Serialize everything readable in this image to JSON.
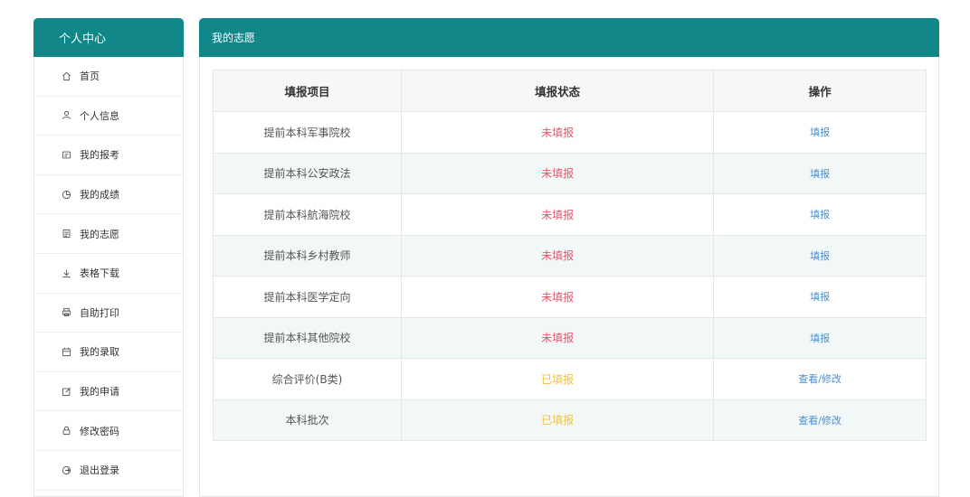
{
  "sidebar": {
    "title": "个人中心",
    "items": [
      {
        "label": "首页",
        "icon": "home-icon"
      },
      {
        "label": "个人信息",
        "icon": "user-icon"
      },
      {
        "label": "我的报考",
        "icon": "id-card-icon"
      },
      {
        "label": "我的成绩",
        "icon": "pie-chart-icon"
      },
      {
        "label": "我的志愿",
        "icon": "document-icon"
      },
      {
        "label": "表格下载",
        "icon": "download-icon"
      },
      {
        "label": "自助打印",
        "icon": "printer-icon"
      },
      {
        "label": "我的录取",
        "icon": "calendar-icon"
      },
      {
        "label": "我的申请",
        "icon": "edit-icon"
      },
      {
        "label": "修改密码",
        "icon": "lock-icon"
      },
      {
        "label": "退出登录",
        "icon": "logout-icon"
      }
    ]
  },
  "main": {
    "title": "我的志愿",
    "table": {
      "headers": [
        "填报项目",
        "填报状态",
        "操作"
      ],
      "rows": [
        {
          "project": "提前本科军事院校",
          "status": "未填报",
          "status_type": "unfilled",
          "action": "填报"
        },
        {
          "project": "提前本科公安政法",
          "status": "未填报",
          "status_type": "unfilled",
          "action": "填报"
        },
        {
          "project": "提前本科航海院校",
          "status": "未填报",
          "status_type": "unfilled",
          "action": "填报"
        },
        {
          "project": "提前本科乡村教师",
          "status": "未填报",
          "status_type": "unfilled",
          "action": "填报"
        },
        {
          "project": "提前本科医学定向",
          "status": "未填报",
          "status_type": "unfilled",
          "action": "填报"
        },
        {
          "project": "提前本科其他院校",
          "status": "未填报",
          "status_type": "unfilled",
          "action": "填报"
        },
        {
          "project": "综合评价(B类)",
          "status": "已填报",
          "status_type": "filled",
          "action": "查看/修改"
        },
        {
          "project": "本科批次",
          "status": "已填报",
          "status_type": "filled",
          "action": "查看/修改"
        }
      ]
    }
  },
  "colors": {
    "header_bg": "#12878a",
    "unfilled": "#e9546b",
    "filled": "#f3c13a",
    "link": "#4a8fd1"
  }
}
